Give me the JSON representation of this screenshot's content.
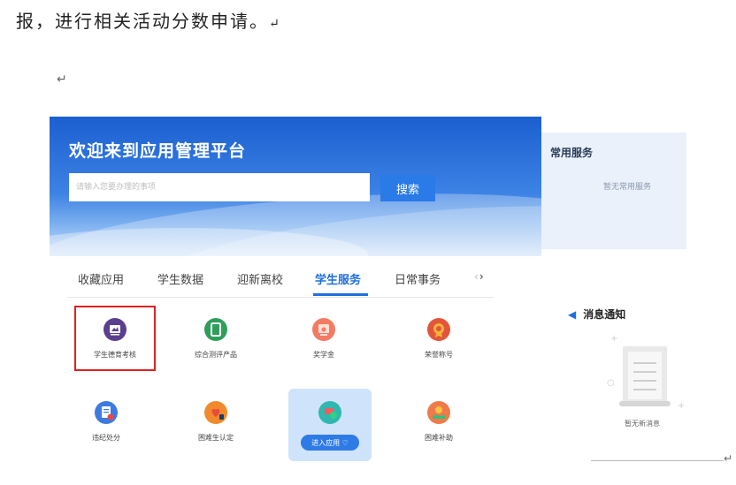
{
  "document": {
    "text_line": "报，进行相关活动分数申请。",
    "paragraph_mark": "↵"
  },
  "hero": {
    "title": "欢迎来到应用管理平台",
    "search_placeholder": "请输入您要办理的事项",
    "search_button": "搜索"
  },
  "common_services": {
    "title": "常用服务",
    "empty_text": "暂无常用服务"
  },
  "tabs": [
    {
      "label": "收藏应用",
      "active": false
    },
    {
      "label": "学生数据",
      "active": false
    },
    {
      "label": "迎新离校",
      "active": false
    },
    {
      "label": "学生服务",
      "active": true
    },
    {
      "label": "日常事务",
      "active": false
    }
  ],
  "tab_nav": {
    "prev": "‹",
    "next": "›"
  },
  "apps": [
    {
      "label": "学生德育考核",
      "icon": "monitor-icon",
      "color": "#5b3f8f",
      "highlighted": true
    },
    {
      "label": "综合测评产品",
      "icon": "tablet-icon",
      "color": "#2f9e5b",
      "highlighted": false
    },
    {
      "label": "奖学金",
      "icon": "certificate-icon",
      "color": "#f47b63",
      "highlighted": false
    },
    {
      "label": "荣誉称号",
      "icon": "medal-icon",
      "color": "#e2553a",
      "highlighted": false
    },
    {
      "label": "违纪处分",
      "icon": "document-warning-icon",
      "color": "#3d7be0",
      "highlighted": false
    },
    {
      "label": "困难生认定",
      "icon": "heart-hand-icon",
      "color": "#f08a2c",
      "highlighted": false
    },
    {
      "label": "进入应用",
      "icon": "card-hand-icon",
      "color": "#2fb7b0",
      "highlighted": false,
      "hover": true
    },
    {
      "label": "困难补助",
      "icon": "hand-coin-icon",
      "color": "#f07a4a",
      "highlighted": false
    }
  ],
  "enter_app_button": "进入应用 ♡",
  "notices": {
    "title": "消息通知",
    "empty_text": "暂无新消息"
  },
  "colors": {
    "accent": "#1f6fe0",
    "highlight_border": "#e02020",
    "hero_top": "#1b5fd0"
  }
}
